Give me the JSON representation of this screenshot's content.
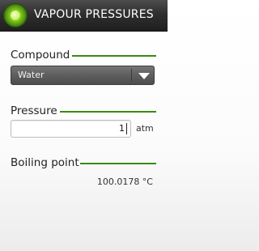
{
  "app": {
    "title": "VAPOUR PRESSURES",
    "icon": "green-orb-icon"
  },
  "compound": {
    "label": "Compound",
    "selected": "Water"
  },
  "pressure": {
    "label": "Pressure",
    "value": "1",
    "unit": "atm"
  },
  "boiling_point": {
    "label": "Boiling point",
    "value": "100.0178 °C"
  },
  "colors": {
    "accent": "#3a8a10",
    "titlebar": "#2f2f2f",
    "dropdown": "#5e5e5e"
  }
}
